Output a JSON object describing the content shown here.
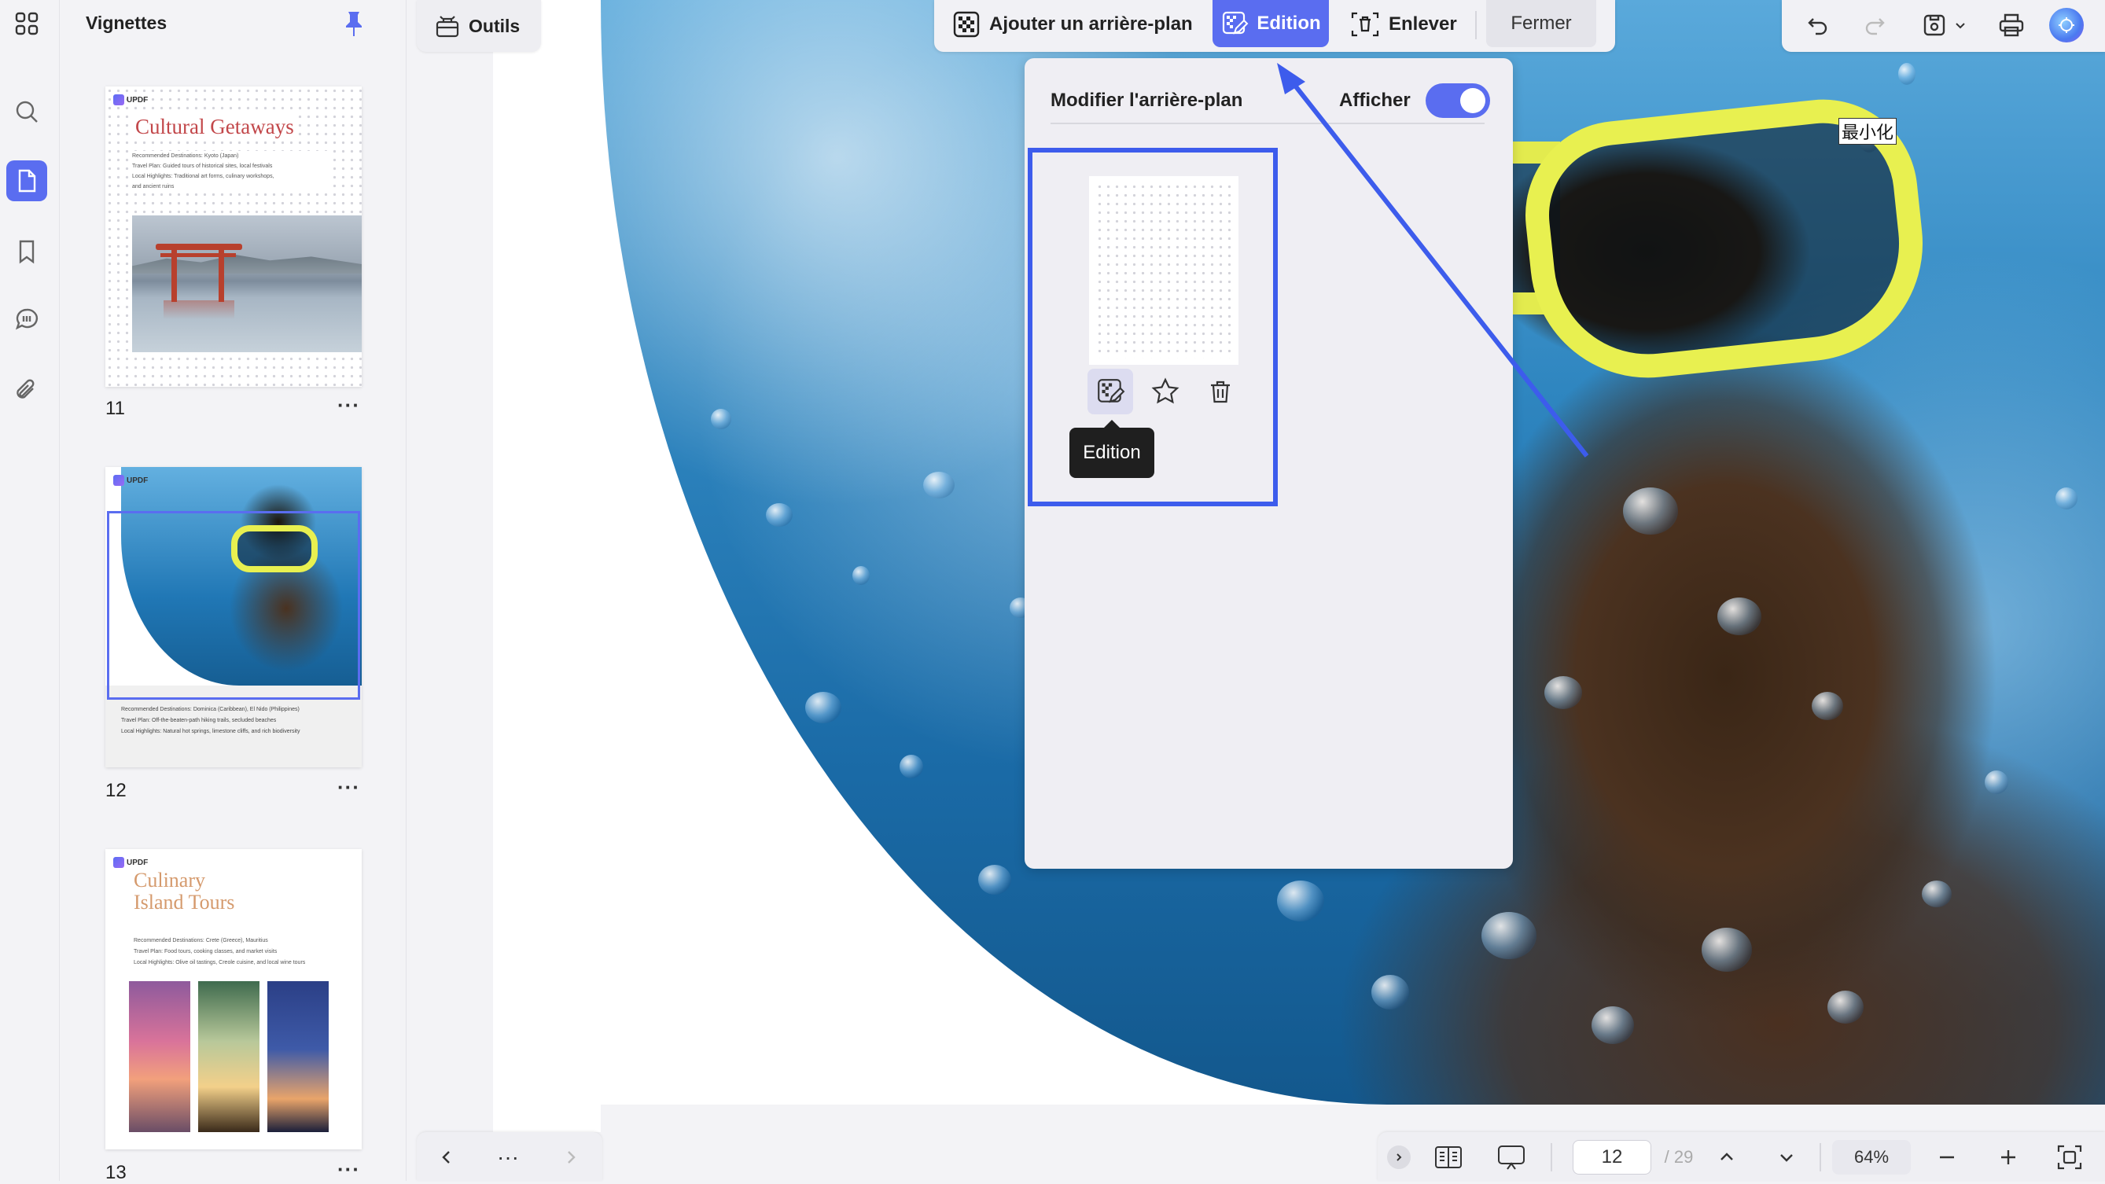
{
  "thumbnails_panel": {
    "title": "Vignettes",
    "pages": [
      {
        "number": "11",
        "more": "···",
        "heading": "Cultural Getaways",
        "lines": [
          "Recommended Destinations: Kyoto (Japan)",
          "Travel Plan: Guided tours of historical sites, local festivals",
          "Local Highlights: Traditional art forms, culinary workshops,",
          "and ancient ruins"
        ]
      },
      {
        "number": "12",
        "more": "···",
        "lines": [
          "Recommended Destinations: Dominica (Caribbean), El Nido (Philippines)",
          "Travel Plan: Off-the-beaten-path hiking trails, secluded beaches",
          "Local Highlights: Natural hot springs, limestone cliffs, and rich biodiversity"
        ]
      },
      {
        "number": "13",
        "more": "···",
        "heading_line1": "Culinary",
        "heading_line2": "Island Tours",
        "lines": [
          "Recommended Destinations: Crete (Greece), Mauritius",
          "Travel Plan: Food tours, cooking classes, and market visits",
          "Local Highlights: Olive oil tastings, Creole cuisine, and local wine tours"
        ]
      }
    ],
    "logo_text": "UPDF"
  },
  "tools": {
    "label": "Outils"
  },
  "background_toolbar": {
    "add_label": "Ajouter un arrière-plan",
    "edit_label": "Edition",
    "remove_label": "Enlever",
    "close_label": "Fermer"
  },
  "edit_panel": {
    "title": "Modifier l'arrière-plan",
    "show_label": "Afficher",
    "show_enabled": true,
    "tooltip": "Edition"
  },
  "overlay_text": "最小化",
  "bottom_bar": {
    "current_page": "12",
    "total_pages": "/ 29",
    "zoom": "64%",
    "nav_more": "···"
  },
  "colors": {
    "accent": "#5a6df0",
    "highlight": "#3d5cec"
  }
}
